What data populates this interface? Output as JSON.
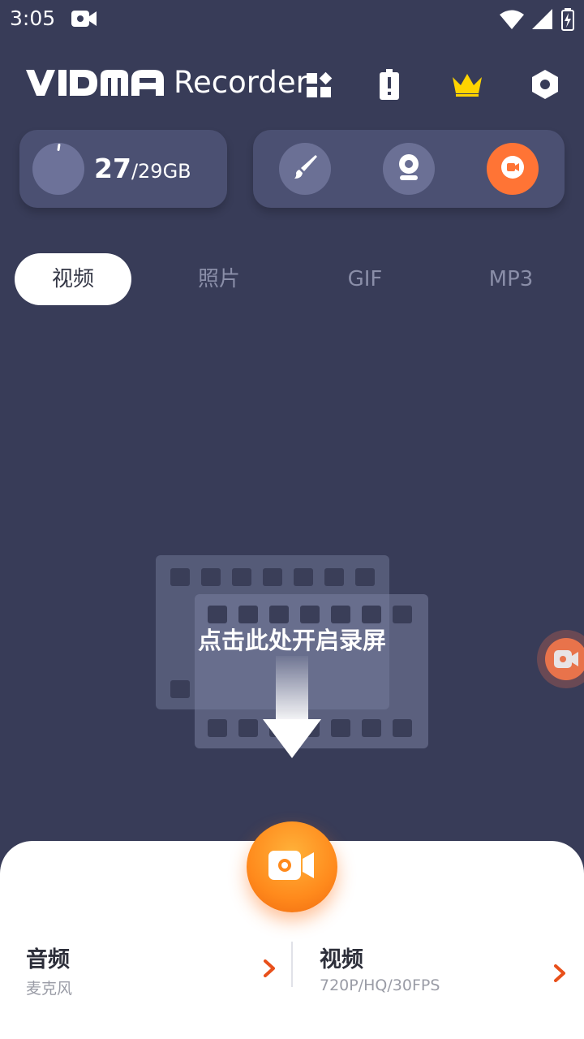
{
  "status_bar": {
    "time": "3:05"
  },
  "header": {
    "logo_text": "VIDMA",
    "app_name": "Recorder"
  },
  "storage": {
    "used": "27",
    "total": "/29GB"
  },
  "tabs": [
    {
      "label": "视频",
      "active": true
    },
    {
      "label": "照片",
      "active": false
    },
    {
      "label": "GIF",
      "active": false
    },
    {
      "label": "MP3",
      "active": false
    }
  ],
  "empty_state": {
    "hint": "点击此处开启录屏"
  },
  "bottom_options": {
    "audio": {
      "title": "音频",
      "subtitle": "麦克风"
    },
    "video": {
      "title": "视频",
      "subtitle": "720P/HQ/30FPS"
    }
  },
  "colors": {
    "background": "#383c58",
    "card": "#4b5072",
    "accent": "#ff7435",
    "crown": "#ffd400",
    "arrow": "#e8501b"
  },
  "icons": {
    "status_left": "video-camera-icon",
    "status_right": [
      "wifi-icon",
      "signal-icon",
      "battery-charging-icon"
    ],
    "header": [
      "apps-grid-icon",
      "battery-alert-icon",
      "crown-icon",
      "settings-icon"
    ],
    "tools": [
      "brush-icon",
      "webcam-icon",
      "record-icon"
    ]
  }
}
